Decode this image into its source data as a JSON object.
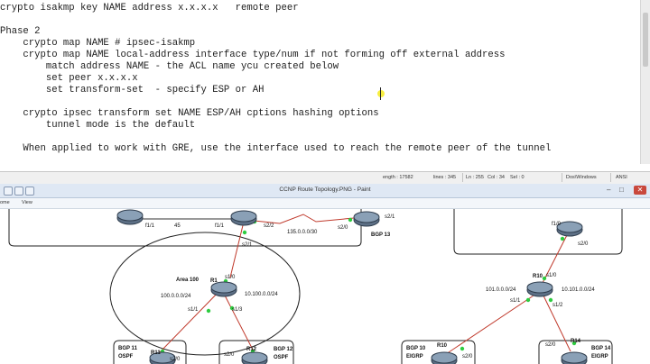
{
  "editor": {
    "lines": [
      "crypto isakmp key NAME address x.x.x.x   remote peer",
      "",
      "Phase 2",
      "    crypto map NAME # ipsec-isakmp",
      "    crypto map NAME local-address interface type/num if not forming off external address",
      "        match address NAME - the ACL name ycu created below",
      "        set peer x.x.x.x",
      "        set transform-set  - specify ESP or AH",
      "",
      "    crypto ipsec transform set NAME ESP/AH cptions hashing options",
      "        tunnel mode is the default",
      "",
      "    When applied to work with GRE, use the interface used to reach the remote peer of the tunnel"
    ],
    "status": {
      "length": "ength : 17582",
      "lines": "lines : 345",
      "ln": "Ln : 255",
      "col": "Col : 34",
      "sel": "Sel : 0",
      "eol": "Dos\\Windows",
      "encoding": "ANSI"
    }
  },
  "paint": {
    "title": "CCNP Route Topology.PNG - Paint",
    "menu": {
      "left": "ome",
      "view": "View"
    },
    "window_buttons": {
      "minimize": "–",
      "maximize": "□",
      "close": "✕"
    },
    "labels": {
      "f1_1_left": "f1/1",
      "link_45": "45",
      "f1_1_mid": "f1/1",
      "s2_2": "s2/2",
      "s2_1_top": "s2/1",
      "net_135": "135.0.0.0/30",
      "s2_0_bgp13": "s2/0",
      "s2_1_bgp13": "s2/1",
      "bgp13": "BGP 13",
      "area100": "Area 100",
      "r1": "R1",
      "s1_0_r1": "s1/0",
      "net_100": "100.0.0.0/24",
      "net_10_100": "10.100.0.0/24",
      "s1_1_r1": "s1/1",
      "s1_3_r1": "s1/3",
      "bgp11": "BGP 11",
      "ospf_l": "OSPF",
      "r11": "R11",
      "s2_0_r11": "s2/0",
      "s2_0_r12": "s2/0",
      "r12": "R12",
      "bgp12": "BGP 12",
      "ospf_r": "OSPF",
      "f1_0_right": "f1/0",
      "s2_0_right": "s2/0",
      "r10": "R10",
      "s1_0_r10": "s1/0",
      "net_101": "101.0.0.0/24",
      "net_10_101": "10.101.0.0/24",
      "s1_1_r10": "s1/1",
      "s1_2_r10": "s1/2",
      "bgp10": "BGP 10",
      "eigrp_l": "EIGRP",
      "r10b": "R10",
      "s2_0_bgp10": "s2/0",
      "s2_0_bgp14": "s2/0",
      "r14": "R14",
      "bgp14": "BGP 14",
      "eigrp_r": "EIGRP"
    }
  }
}
